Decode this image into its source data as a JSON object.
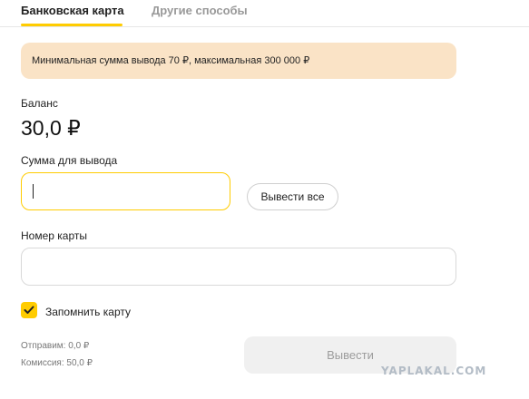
{
  "tabs": {
    "bank_card": "Банковская карта",
    "other_methods": "Другие способы"
  },
  "notice": {
    "text": "Минимальная сумма вывода 70 ₽, максимальная 300 000 ₽"
  },
  "balance": {
    "label": "Баланс",
    "value": "30,0 ₽"
  },
  "amount": {
    "label": "Сумма для вывода",
    "value": "",
    "withdraw_all_label": "Вывести все"
  },
  "card": {
    "label": "Номер карты",
    "value": ""
  },
  "remember_card": {
    "label": "Запомнить карту",
    "checked": true
  },
  "summary": {
    "send": "Отправим: 0,0 ₽",
    "fee": "Комиссия: 50,0 ₽"
  },
  "submit": {
    "label": "Вывести",
    "disabled": true
  },
  "watermark": {
    "text": "YAPLAKAL.COM"
  },
  "colors": {
    "accent": "#ffcc00",
    "notice_bg": "#fae3c6",
    "disabled_button_bg": "#f0f0f0"
  }
}
